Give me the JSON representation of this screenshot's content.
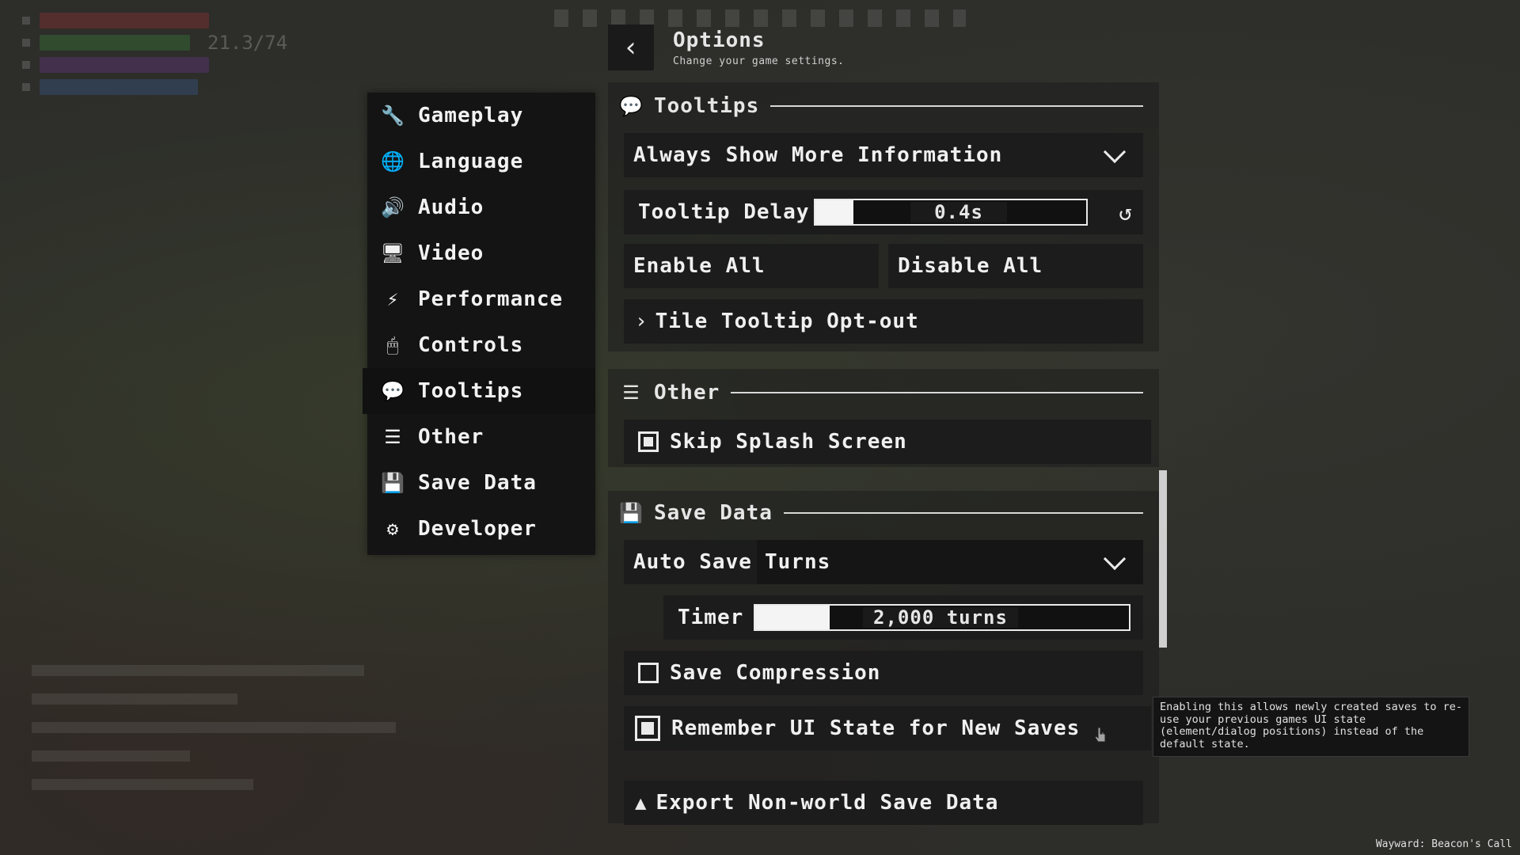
{
  "header": {
    "title": "Options",
    "subtitle": "Change your game settings."
  },
  "sidebar": {
    "items": [
      {
        "label": "Gameplay"
      },
      {
        "label": "Language"
      },
      {
        "label": "Audio"
      },
      {
        "label": "Video"
      },
      {
        "label": "Performance"
      },
      {
        "label": "Controls"
      },
      {
        "label": "Tooltips"
      },
      {
        "label": "Other"
      },
      {
        "label": "Save Data"
      },
      {
        "label": "Developer"
      }
    ],
    "active": "Tooltips"
  },
  "tooltips_section": {
    "title": "Tooltips",
    "mode_select": "Always Show More Information",
    "delay_label": "Tooltip Delay",
    "delay_value": "0.4s",
    "delay_fraction": 0.14,
    "enable_all": "Enable All",
    "disable_all": "Disable All",
    "tile_optout": "Tile Tooltip Opt-out"
  },
  "other_section": {
    "title": "Other",
    "skip_splash": "Skip Splash Screen",
    "skip_splash_checked": true
  },
  "save_section": {
    "title": "Save Data",
    "autosave_label": "Auto Save",
    "autosave_value": "Turns",
    "timer_label": "Timer",
    "timer_value": "2,000 turns",
    "timer_fraction": 0.2,
    "compression": "Save Compression",
    "compression_checked": false,
    "remember_ui": "Remember UI State for New Saves",
    "remember_ui_checked": true,
    "export": "Export Non-world Save Data"
  },
  "tooltip_popup": {
    "text": "Enabling this allows newly created saves to re-use your previous games UI state (element/dialog positions) instead of the default state."
  },
  "hud": {
    "percent": "21.3/74"
  },
  "footer": {
    "credit": "Wayward: Beacon's Call"
  },
  "colors": {
    "panel": "#1c1c1c",
    "text": "#f0f0f0",
    "sidebar": "#141414"
  }
}
